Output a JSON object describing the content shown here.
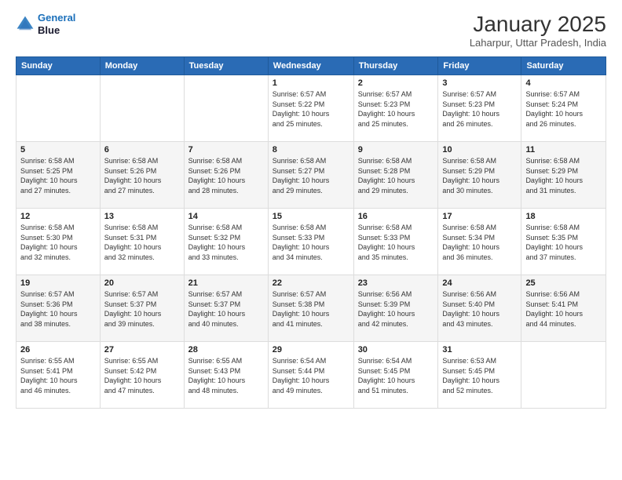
{
  "header": {
    "logo_line1": "General",
    "logo_line2": "Blue",
    "month_title": "January 2025",
    "location": "Laharpur, Uttar Pradesh, India"
  },
  "weekdays": [
    "Sunday",
    "Monday",
    "Tuesday",
    "Wednesday",
    "Thursday",
    "Friday",
    "Saturday"
  ],
  "weeks": [
    [
      {
        "day": "",
        "info": ""
      },
      {
        "day": "",
        "info": ""
      },
      {
        "day": "",
        "info": ""
      },
      {
        "day": "1",
        "info": "Sunrise: 6:57 AM\nSunset: 5:22 PM\nDaylight: 10 hours\nand 25 minutes."
      },
      {
        "day": "2",
        "info": "Sunrise: 6:57 AM\nSunset: 5:23 PM\nDaylight: 10 hours\nand 25 minutes."
      },
      {
        "day": "3",
        "info": "Sunrise: 6:57 AM\nSunset: 5:23 PM\nDaylight: 10 hours\nand 26 minutes."
      },
      {
        "day": "4",
        "info": "Sunrise: 6:57 AM\nSunset: 5:24 PM\nDaylight: 10 hours\nand 26 minutes."
      }
    ],
    [
      {
        "day": "5",
        "info": "Sunrise: 6:58 AM\nSunset: 5:25 PM\nDaylight: 10 hours\nand 27 minutes."
      },
      {
        "day": "6",
        "info": "Sunrise: 6:58 AM\nSunset: 5:26 PM\nDaylight: 10 hours\nand 27 minutes."
      },
      {
        "day": "7",
        "info": "Sunrise: 6:58 AM\nSunset: 5:26 PM\nDaylight: 10 hours\nand 28 minutes."
      },
      {
        "day": "8",
        "info": "Sunrise: 6:58 AM\nSunset: 5:27 PM\nDaylight: 10 hours\nand 29 minutes."
      },
      {
        "day": "9",
        "info": "Sunrise: 6:58 AM\nSunset: 5:28 PM\nDaylight: 10 hours\nand 29 minutes."
      },
      {
        "day": "10",
        "info": "Sunrise: 6:58 AM\nSunset: 5:29 PM\nDaylight: 10 hours\nand 30 minutes."
      },
      {
        "day": "11",
        "info": "Sunrise: 6:58 AM\nSunset: 5:29 PM\nDaylight: 10 hours\nand 31 minutes."
      }
    ],
    [
      {
        "day": "12",
        "info": "Sunrise: 6:58 AM\nSunset: 5:30 PM\nDaylight: 10 hours\nand 32 minutes."
      },
      {
        "day": "13",
        "info": "Sunrise: 6:58 AM\nSunset: 5:31 PM\nDaylight: 10 hours\nand 32 minutes."
      },
      {
        "day": "14",
        "info": "Sunrise: 6:58 AM\nSunset: 5:32 PM\nDaylight: 10 hours\nand 33 minutes."
      },
      {
        "day": "15",
        "info": "Sunrise: 6:58 AM\nSunset: 5:33 PM\nDaylight: 10 hours\nand 34 minutes."
      },
      {
        "day": "16",
        "info": "Sunrise: 6:58 AM\nSunset: 5:33 PM\nDaylight: 10 hours\nand 35 minutes."
      },
      {
        "day": "17",
        "info": "Sunrise: 6:58 AM\nSunset: 5:34 PM\nDaylight: 10 hours\nand 36 minutes."
      },
      {
        "day": "18",
        "info": "Sunrise: 6:58 AM\nSunset: 5:35 PM\nDaylight: 10 hours\nand 37 minutes."
      }
    ],
    [
      {
        "day": "19",
        "info": "Sunrise: 6:57 AM\nSunset: 5:36 PM\nDaylight: 10 hours\nand 38 minutes."
      },
      {
        "day": "20",
        "info": "Sunrise: 6:57 AM\nSunset: 5:37 PM\nDaylight: 10 hours\nand 39 minutes."
      },
      {
        "day": "21",
        "info": "Sunrise: 6:57 AM\nSunset: 5:37 PM\nDaylight: 10 hours\nand 40 minutes."
      },
      {
        "day": "22",
        "info": "Sunrise: 6:57 AM\nSunset: 5:38 PM\nDaylight: 10 hours\nand 41 minutes."
      },
      {
        "day": "23",
        "info": "Sunrise: 6:56 AM\nSunset: 5:39 PM\nDaylight: 10 hours\nand 42 minutes."
      },
      {
        "day": "24",
        "info": "Sunrise: 6:56 AM\nSunset: 5:40 PM\nDaylight: 10 hours\nand 43 minutes."
      },
      {
        "day": "25",
        "info": "Sunrise: 6:56 AM\nSunset: 5:41 PM\nDaylight: 10 hours\nand 44 minutes."
      }
    ],
    [
      {
        "day": "26",
        "info": "Sunrise: 6:55 AM\nSunset: 5:41 PM\nDaylight: 10 hours\nand 46 minutes."
      },
      {
        "day": "27",
        "info": "Sunrise: 6:55 AM\nSunset: 5:42 PM\nDaylight: 10 hours\nand 47 minutes."
      },
      {
        "day": "28",
        "info": "Sunrise: 6:55 AM\nSunset: 5:43 PM\nDaylight: 10 hours\nand 48 minutes."
      },
      {
        "day": "29",
        "info": "Sunrise: 6:54 AM\nSunset: 5:44 PM\nDaylight: 10 hours\nand 49 minutes."
      },
      {
        "day": "30",
        "info": "Sunrise: 6:54 AM\nSunset: 5:45 PM\nDaylight: 10 hours\nand 51 minutes."
      },
      {
        "day": "31",
        "info": "Sunrise: 6:53 AM\nSunset: 5:45 PM\nDaylight: 10 hours\nand 52 minutes."
      },
      {
        "day": "",
        "info": ""
      }
    ]
  ]
}
